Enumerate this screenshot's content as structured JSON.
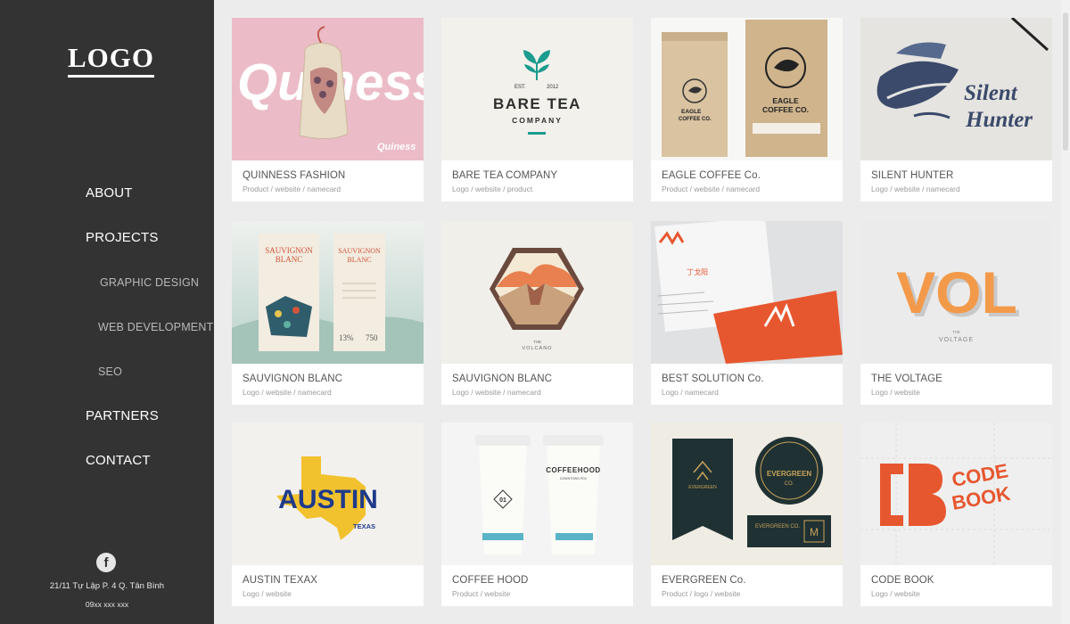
{
  "brand": {
    "logo": "LOGO"
  },
  "nav": {
    "about": "ABOUT",
    "projects": "PROJECTS",
    "graphic_design": "GRAPHIC DESIGN",
    "web_development": "WEB DEVELOPMENT",
    "seo": "SEO",
    "partners": "PARTNERS",
    "contact": "CONTACT"
  },
  "footer": {
    "social_icon": "f",
    "address": "21/11 Tự Lập P. 4 Q. Tân Bình",
    "phone": "09xx xxx xxx"
  },
  "projects": [
    {
      "title": "QUINNESS FASHION",
      "tags": "Product / website / namecard",
      "icon": "drawstring-bag-image",
      "image_text": [
        "Quiness",
        "Quiness"
      ],
      "bg": "#e9b9c4"
    },
    {
      "title": "BARE TEA COMPANY",
      "tags": "Logo / website / product",
      "icon": "tea-leaf-logo-image",
      "image_text": [
        "EST.",
        "2012",
        "BARE TEA",
        "COMPANY"
      ],
      "bg": "#f3f1ec"
    },
    {
      "title": "EAGLE COFFEE Co.",
      "tags": "Product / website / namecard",
      "icon": "coffee-bag-image",
      "image_text": [
        "EAGLE",
        "COFFEE CO.",
        "EAGLE",
        "COFFEE CO."
      ],
      "bg": "#f7f7f5"
    },
    {
      "title": "SILENT HUNTER",
      "tags": "Logo / website / namecard",
      "icon": "fish-illustration-image",
      "image_text": [
        "Silent",
        "Hunter"
      ],
      "bg": "#e4e3df"
    },
    {
      "title": "SAUVIGNON BLANC",
      "tags": "Logo / website / namecard",
      "icon": "wine-label-image",
      "image_text": [
        "SAUVIGNON",
        "BLANC",
        "SAUVIGNON",
        "BLANC",
        "13%",
        "750"
      ],
      "bg": "#d5e4dd"
    },
    {
      "title": "SAUVIGNON BLANC",
      "tags": "Logo / website / namecard",
      "icon": "volcano-badge-image",
      "image_text": [
        "THE",
        "VOLCANO"
      ],
      "bg": "#f1efea"
    },
    {
      "title": "BEST SOLUTION Co.",
      "tags": "Logo / namecard",
      "icon": "business-card-image",
      "image_text": [
        "丁戈阳"
      ],
      "bg": "#dfe1e3"
    },
    {
      "title": "THE VOLTAGE",
      "tags": "Logo / website",
      "icon": "voltage-letters-image",
      "image_text": [
        "VOL",
        "THE",
        "VOLTAGE"
      ],
      "bg": "#eaeaea"
    },
    {
      "title": "AUSTIN TEXAX",
      "tags": "Logo / website",
      "icon": "texas-map-image",
      "image_text": [
        "AUSTIN",
        "TEXAS"
      ],
      "bg": "#f2f1ee"
    },
    {
      "title": "COFFEE HOOD",
      "tags": "Product / website",
      "icon": "coffee-cup-image",
      "image_text": [
        "COFFEEHOOD",
        "DOWNTOWN PDX",
        "01"
      ],
      "bg": "#f4f4f4"
    },
    {
      "title": "EVERGREEN Co.",
      "tags": "Product / logo / website",
      "icon": "evergreen-badge-image",
      "image_text": [
        "EVERGREEN",
        "EVERGREEN",
        "CO.",
        "EVERGREEN CO.",
        "M"
      ],
      "bg": "#efece4"
    },
    {
      "title": "CODE BOOK",
      "tags": "Logo / website",
      "icon": "codebook-logo-image",
      "image_text": [
        "CODE",
        "BOOK"
      ],
      "bg": "#efefef"
    }
  ],
  "colors": {
    "sidebar_bg": "#333333",
    "page_bg": "#ececec",
    "card_bg": "#ffffff",
    "accent_teal": "#1b9c8e",
    "accent_orange": "#e7572f"
  }
}
